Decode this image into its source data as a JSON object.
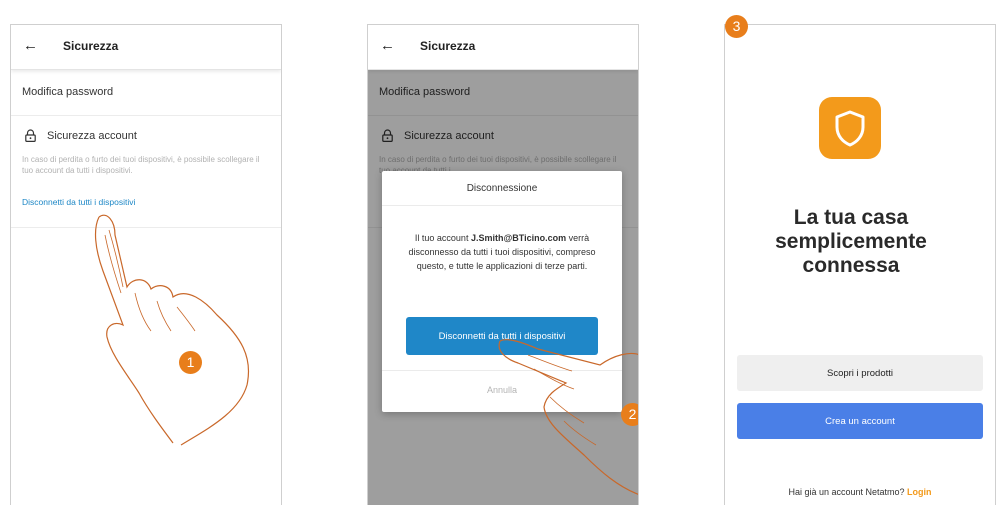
{
  "screen1": {
    "back_icon": "arrow-left-icon",
    "title": "Sicurezza",
    "password_row": "Modifica password",
    "account_section_title": "Sicurezza account",
    "account_section_desc": "In caso di perdita o furto dei tuoi dispositivi, è possibile scollegare il tuo account da tutti i dispositivi.",
    "disconnect_link": "Disconnetti da tutti i dispositivi",
    "step_number": "1"
  },
  "screen2": {
    "title": "Sicurezza",
    "password_row": "Modifica password",
    "account_section_title": "Sicurezza account",
    "account_section_desc": "In caso di perdita o furto dei tuoi dispositivi, è possibile scollegare il tuo account da tutti i",
    "dialog": {
      "title": "Disconnessione",
      "body_prefix": "Il tuo account ",
      "account_email": "J.Smith@BTicino.com",
      "body_suffix": " verrà disconnesso da tutti i tuoi dispositivi, compreso questo, e tutte le applicazioni di terze parti.",
      "confirm_button": "Disconnetti da tutti i dispositivi",
      "cancel_button": "Annulla"
    },
    "step_number": "2"
  },
  "screen3": {
    "app_icon": "shield-icon",
    "tagline_line1": "La tua casa",
    "tagline_line2": "semplicemente",
    "tagline_line3": "connessa",
    "discover_button": "Scopri i prodotti",
    "create_account_button": "Crea un account",
    "login_prompt": "Hai già un account Netatmo? ",
    "login_link": "Login",
    "step_number": "3"
  },
  "colors": {
    "accent_orange": "#e87e1b",
    "link_blue": "#1d87c6",
    "primary_blue": "#4a7fe7",
    "dialog_button_blue": "#1f87c8",
    "app_icon_orange": "#f39a1b"
  }
}
